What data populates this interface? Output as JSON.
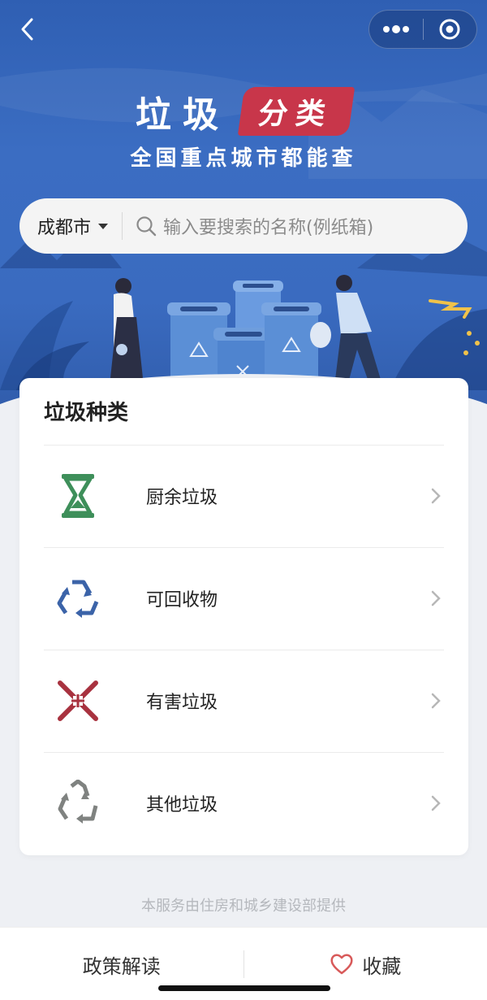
{
  "header": {
    "title_main": "垃圾",
    "title_tag": "分类",
    "subtitle": "全国重点城市都能查"
  },
  "search": {
    "city": "成都市",
    "placeholder": "输入要搜索的名称(例纸箱)"
  },
  "categories": {
    "title": "垃圾种类",
    "items": [
      {
        "label": "厨余垃圾",
        "icon": "hourglass-icon",
        "color": "#3e8f5a"
      },
      {
        "label": "可回收物",
        "icon": "recycle-icon",
        "color": "#3b63a8"
      },
      {
        "label": "有害垃圾",
        "icon": "hazard-cross-icon",
        "color": "#a8323f"
      },
      {
        "label": "其他垃圾",
        "icon": "recycle-icon",
        "color": "#7f8280"
      }
    ]
  },
  "footer_note": "本服务由住房和城乡建设部提供",
  "tabbar": {
    "policy_label": "政策解读",
    "favorite_label": "收藏"
  },
  "colors": {
    "hero_blue": "#3a6bc0",
    "tag_red": "#c8364a",
    "heart_red": "#d85a5a"
  }
}
